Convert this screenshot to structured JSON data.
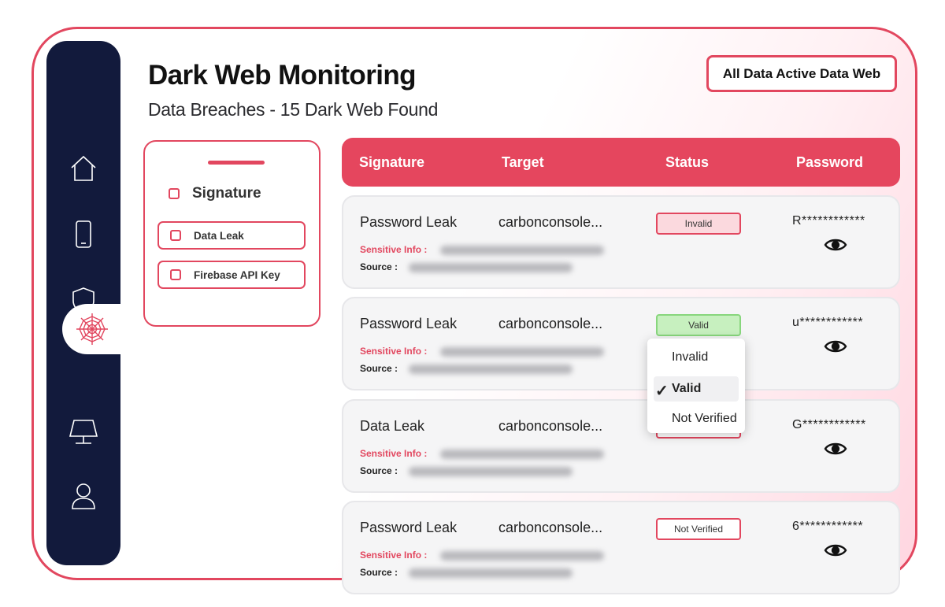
{
  "header": {
    "title": "Dark Web Monitoring",
    "subtitle": "Data Breaches - 15 Dark Web Found",
    "action_button": "All Data Active Data Web"
  },
  "sidebar": {
    "items": [
      {
        "icon": "home-icon"
      },
      {
        "icon": "mobile-icon"
      },
      {
        "icon": "shield-icon"
      },
      {
        "icon": "spider-web-icon",
        "active": true
      },
      {
        "icon": "monitor-icon"
      },
      {
        "icon": "user-icon"
      }
    ]
  },
  "filter": {
    "header": "Signature",
    "options": [
      "Data Leak",
      "Firebase API Key"
    ]
  },
  "table": {
    "columns": [
      "Signature",
      "Target",
      "Status",
      "Password"
    ],
    "sensitive_label": "Sensitive Info :",
    "source_label": "Source :",
    "rows": [
      {
        "signature": "Password Leak",
        "target": "carbonconsole...",
        "status": "Invalid",
        "password": "R************"
      },
      {
        "signature": "Password Leak",
        "target": "carbonconsole...",
        "status": "Valid",
        "password": "u************"
      },
      {
        "signature": "Data Leak",
        "target": "carbonconsole...",
        "status": "",
        "password": "G************"
      },
      {
        "signature": "Password Leak",
        "target": "carbonconsole...",
        "status": "Not Verified",
        "password": "6************"
      }
    ]
  },
  "status_dropdown": {
    "options": [
      "Invalid",
      "Valid",
      "Not Verified"
    ],
    "selected": "Valid",
    "check_glyph": "✓"
  },
  "colors": {
    "accent": "#e5465e",
    "sidebar": "#121a3c",
    "valid_bg": "#c7f0bf",
    "invalid_bg": "#fbd9de"
  }
}
